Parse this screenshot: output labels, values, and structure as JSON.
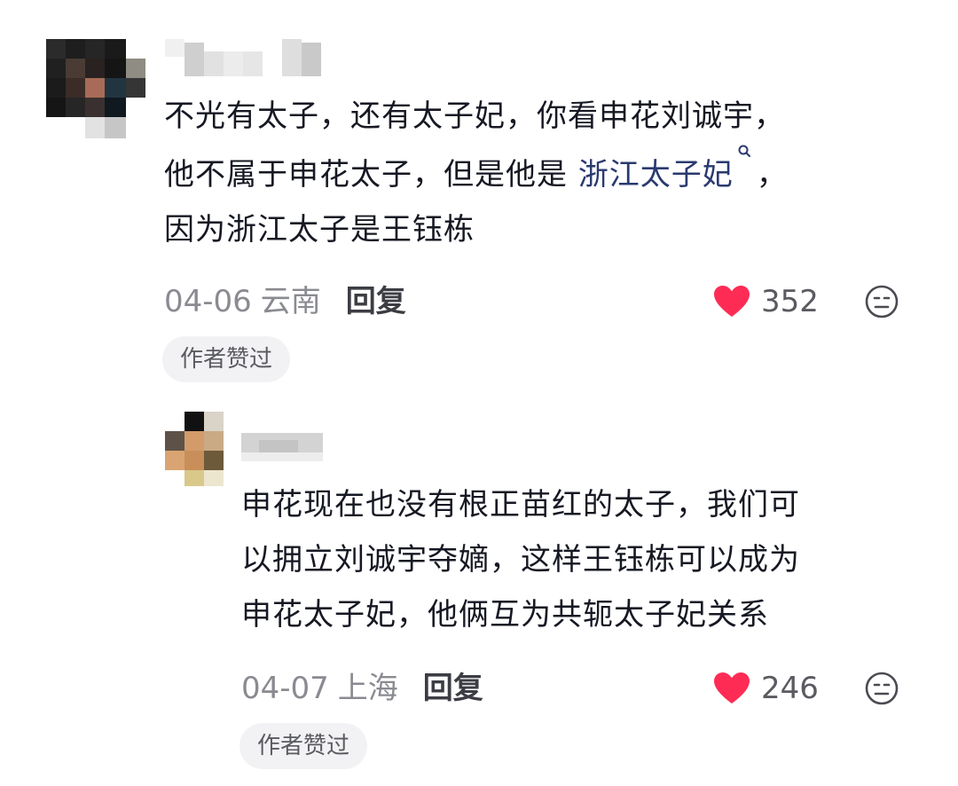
{
  "comments": [
    {
      "text_lines": [
        "不光有太子，还有太子妃，你看申花刘诚宇，",
        "他不属于申花太子，但是他是 "
      ],
      "link_text": "浙江太子妃",
      "after_link": "，",
      "last_line": "因为浙江太子是王钰栋",
      "date": "04-06",
      "location": "云南",
      "reply_label": "回复",
      "likes": "352",
      "badge": "作者赞过"
    },
    {
      "text_lines": [
        "申花现在也没有根正苗红的太子，我们可",
        "以拥立刘诚宇夺嫡，这样王钰栋可以成为",
        "申花太子妃，他俩互为共轭太子妃关系"
      ],
      "date": "04-07",
      "location": "上海",
      "reply_label": "回复",
      "likes": "246",
      "badge": "作者赞过"
    }
  ],
  "icons": {
    "like": "heart-icon",
    "emoji": "emoji-face-icon",
    "search": "search-icon"
  },
  "colors": {
    "heart": "#fe2c55",
    "link": "#2a3a6f",
    "meta": "#8a8b91",
    "badge_bg": "#f2f2f4"
  }
}
